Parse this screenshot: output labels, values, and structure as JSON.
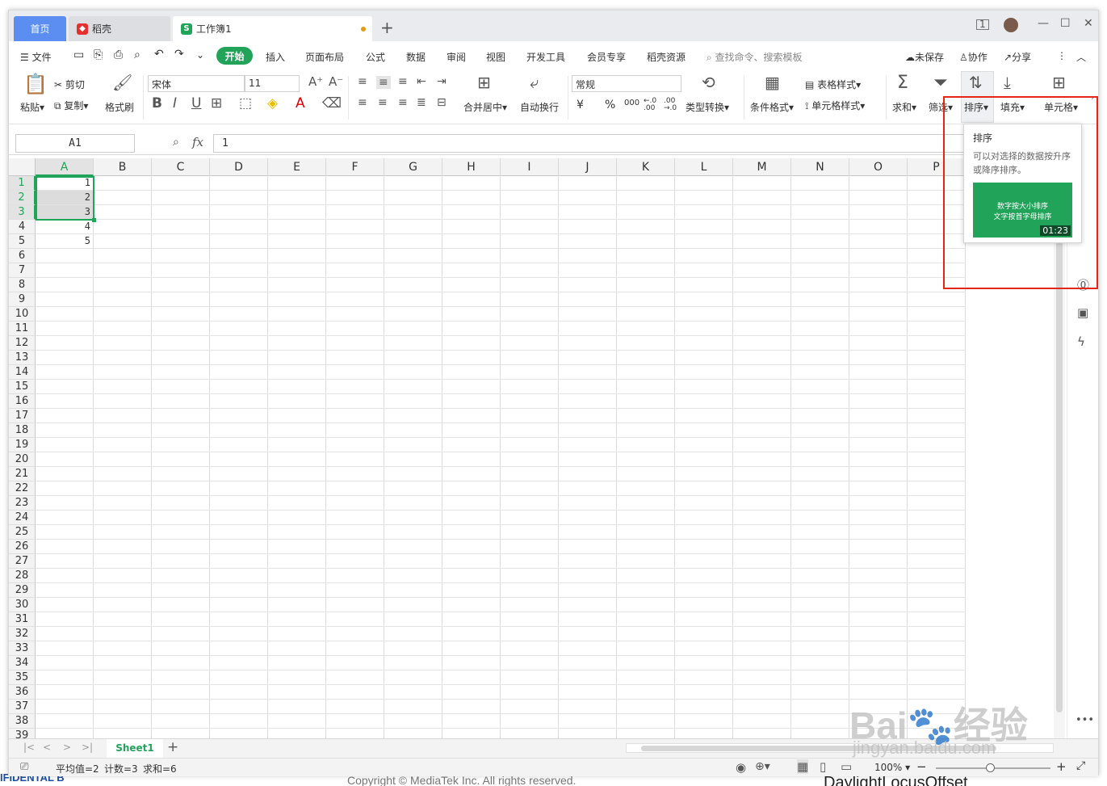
{
  "tabs": {
    "home": "首页",
    "doc": "稻壳",
    "book": "工作簿1",
    "new": "+"
  },
  "window_controls": {
    "min": "—",
    "max": "☐",
    "close": "✕"
  },
  "menu": {
    "file": "文件",
    "items": [
      "开始",
      "插入",
      "页面布局",
      "公式",
      "数据",
      "审阅",
      "视图",
      "开发工具",
      "会员专享",
      "稻壳资源"
    ],
    "search": "查找命令、搜索模板",
    "unsaved": "未保存",
    "collab": "协作",
    "share": "分享"
  },
  "ribbon": {
    "paste": "粘贴",
    "cut": "剪切",
    "copy": "复制",
    "format_painter": "格式刷",
    "font_name": "宋体",
    "font_size": "11",
    "merge_center": "合并居中",
    "wrap": "自动换行",
    "number_format": "常规",
    "type_convert": "类型转换",
    "cond_format": "条件格式",
    "table_style": "表格样式",
    "cell_style": "单元格样式",
    "sum": "求和",
    "filter": "筛选",
    "sort": "排序",
    "fill": "填充",
    "cell": "单元格",
    "currency": "¥",
    "percent": "%",
    "thousands": "000",
    "inc_dec": "←.0 .00",
    "dec_dec": ".00 →.0"
  },
  "formula_bar": {
    "cell_ref": "A1",
    "fx": "fx",
    "value": "1"
  },
  "columns": [
    "A",
    "B",
    "C",
    "D",
    "E",
    "F",
    "G",
    "H",
    "I",
    "J",
    "K",
    "L",
    "M",
    "N",
    "O",
    "P"
  ],
  "rows": [
    "1",
    "2",
    "3",
    "4",
    "5",
    "6",
    "7",
    "8",
    "9",
    "10",
    "11",
    "12",
    "13",
    "14",
    "15",
    "16",
    "17",
    "18",
    "19",
    "20",
    "21",
    "22",
    "23",
    "24",
    "25",
    "26",
    "27",
    "28",
    "29",
    "30",
    "31",
    "32",
    "33",
    "34",
    "35",
    "36",
    "37",
    "38",
    "39"
  ],
  "cells_A": [
    "1",
    "2",
    "3",
    "4",
    "5"
  ],
  "tooltip": {
    "title": "排序",
    "desc": "可以对选择的数据按升序或降序排序。",
    "thumb_line1": "数字按大小排序",
    "thumb_line2": "文字按首字母排序",
    "duration": "01:23"
  },
  "sheet": {
    "name": "Sheet1",
    "add": "+"
  },
  "status": {
    "avg": "平均值=2",
    "count": "计数=3",
    "sum": "求和=6",
    "zoom": "100%"
  },
  "background": {
    "footer_left": "IFIDENTAL B",
    "footer_mid": "Copyright © MediaTek Inc. All rights reserved.",
    "footer_right": "DaylightLocusOffset"
  },
  "watermark": {
    "logo": "Bai",
    "logo2": "经验",
    "url": "jingyan.baidu.com"
  },
  "colors": {
    "accent": "#21a35a",
    "tab_blue": "#5b8ef0",
    "highlight": "#e42617"
  }
}
